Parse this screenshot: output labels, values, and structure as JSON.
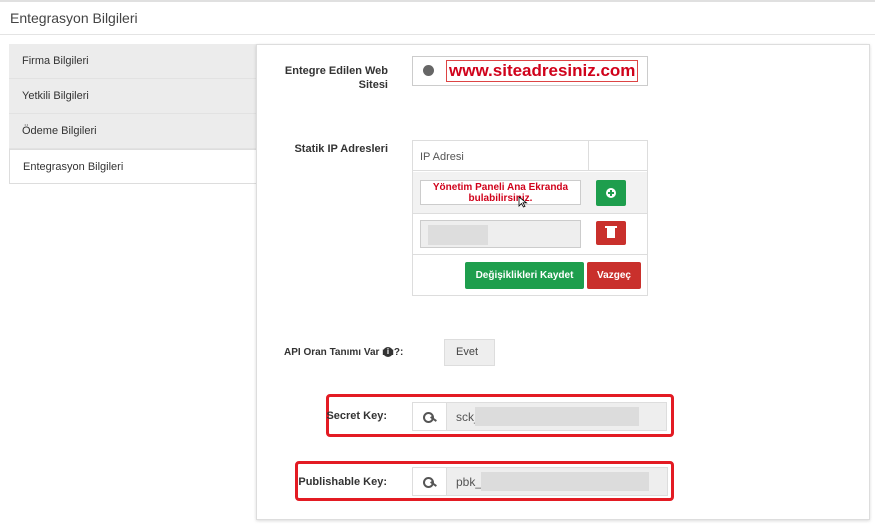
{
  "page": {
    "title": "Entegrasyon Bilgileri"
  },
  "sidebar": {
    "items": [
      {
        "label": "Firma Bilgileri"
      },
      {
        "label": "Yetkili Bilgileri"
      },
      {
        "label": "Ödeme Bilgileri"
      },
      {
        "label": "Entegrasyon Bilgileri",
        "active": true
      }
    ]
  },
  "form": {
    "website_label_line1": "Entegre Edilen Web",
    "website_label_line2": "Sitesi",
    "website_value": "www.siteadresiniz.com",
    "static_ip_label": "Statik IP Adresleri",
    "ip_table_header": "IP Adresi",
    "ip_note_line1": "Yönetim Paneli Ana Ekranda",
    "ip_note_line2": "bulabilirsiniz.",
    "save_label": "Değişiklikleri Kaydet",
    "cancel_label": "Vazgeç",
    "api_rate_label": "API Oran Tanımı Var mı?:",
    "api_rate_value": "Evet",
    "secret_key_label": "Secret Key:",
    "secret_key_prefix": "sck_",
    "publishable_key_label": "Publishable Key:",
    "publishable_key_prefix": "pbk_"
  },
  "colors": {
    "primary_green": "#1e9e4d",
    "danger_red": "#c9302c",
    "highlight_red": "#e31b23",
    "annotation_red": "#d0021b"
  },
  "icons": [
    "globe-icon",
    "plus-circle-icon",
    "trash-icon",
    "info-icon",
    "key-icon",
    "cursor-icon"
  ]
}
